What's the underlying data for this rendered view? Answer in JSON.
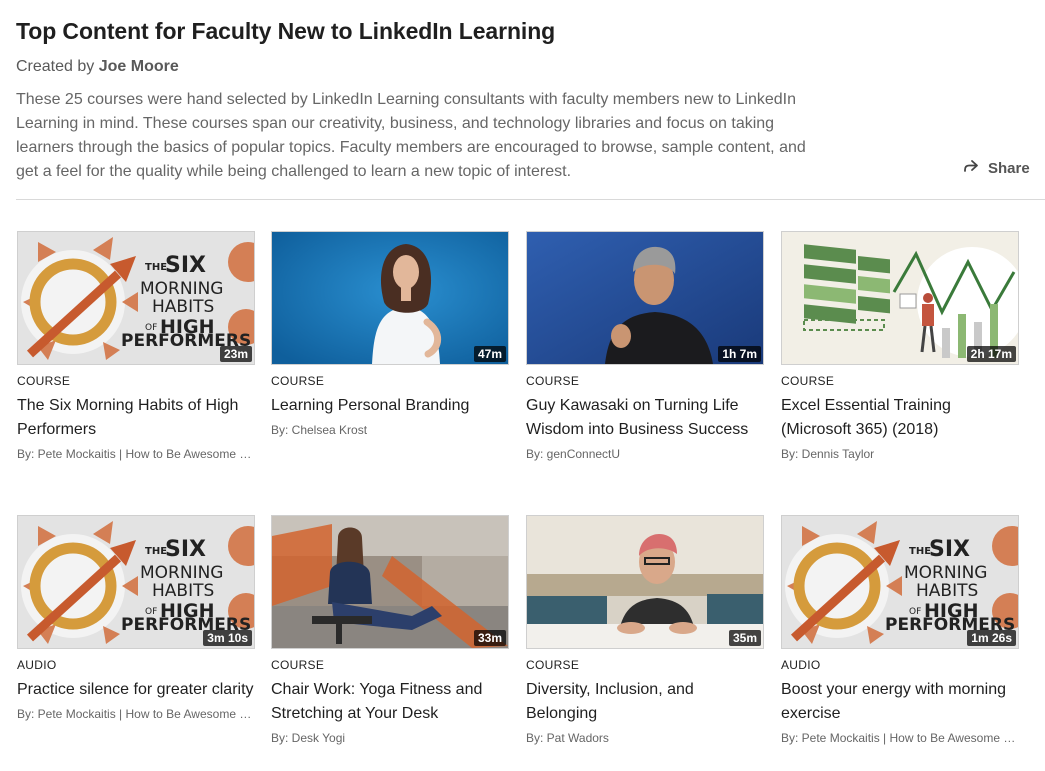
{
  "header": {
    "title": "Top Content for Faculty New to LinkedIn Learning",
    "created_by_prefix": "Created by",
    "author": "Joe Moore",
    "description": "These 25 courses were hand selected by LinkedIn Learning consultants with faculty members new to LinkedIn Learning in mind. These courses span our creativity, business, and technology libraries and focus on taking learners through the basics of popular topics. Faculty members are encouraged to browse, sample content, and get a feel for the quality while being challenged to learn a new topic of interest.",
    "share_label": "Share",
    "share_icon": "share-arrow-icon"
  },
  "thumbnail_text": {
    "the": "THE",
    "six": "SIX",
    "morning": "MORNING",
    "habits": "HABITS",
    "of": "OF",
    "high": "HIGH",
    "performers": "PERFORMERS"
  },
  "cards": [
    {
      "type": "COURSE",
      "title": "The Six Morning Habits of High Performers",
      "author": "By: Pete Mockaitis | How to Be Awesome at Your Job",
      "duration": "23m",
      "thumbnail": "six-morning-habits"
    },
    {
      "type": "COURSE",
      "title": "Learning Personal Branding",
      "author": "By: Chelsea Krost",
      "duration": "47m",
      "thumbnail": "personal-branding-portrait"
    },
    {
      "type": "COURSE",
      "title": "Guy Kawasaki on Turning Life Wisdom into Business Success",
      "author": "By: genConnectU",
      "duration": "1h 7m",
      "thumbnail": "speaker-portrait"
    },
    {
      "type": "COURSE",
      "title": "Excel Essential Training (Microsoft 365) (2018)",
      "author": "By: Dennis Taylor",
      "duration": "2h 17m",
      "thumbnail": "excel-chart-illustration"
    },
    {
      "type": "AUDIO",
      "title": "Practice silence for greater clarity",
      "author": "By: Pete Mockaitis | How to Be Awesome at Your Job",
      "duration": "3m 10s",
      "thumbnail": "six-morning-habits"
    },
    {
      "type": "COURSE",
      "title": "Chair Work: Yoga Fitness and Stretching at Your Desk",
      "author": "By: Desk Yogi",
      "duration": "33m",
      "thumbnail": "yoga-office-photo"
    },
    {
      "type": "COURSE",
      "title": "Diversity, Inclusion, and Belonging",
      "author": "By: Pat Wadors",
      "duration": "35m",
      "thumbnail": "presenter-at-table"
    },
    {
      "type": "AUDIO",
      "title": "Boost your energy with morning exercise",
      "author": "By: Pete Mockaitis | How to Be Awesome at Your Job",
      "duration": "1m 26s",
      "thumbnail": "six-morning-habits"
    }
  ]
}
